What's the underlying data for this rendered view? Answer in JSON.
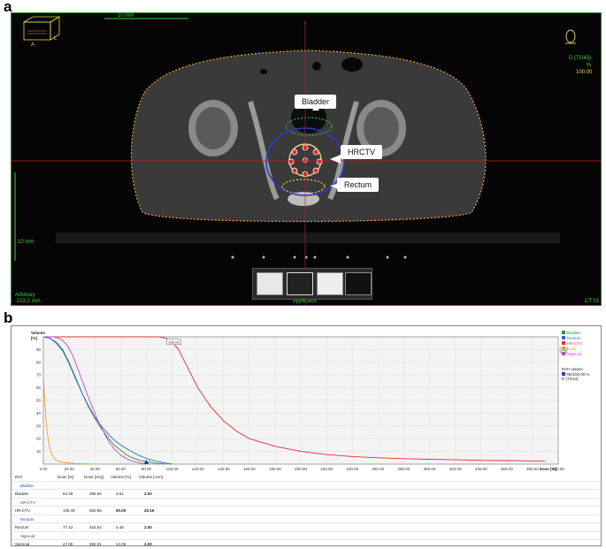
{
  "panels": {
    "a_label": "a",
    "b_label": "b"
  },
  "ct_view": {
    "scale_top": "10 mm",
    "scale_left": "10 mm",
    "orient_a": "A",
    "orient_l": "L",
    "top_marker": "x",
    "dose_label": "D (TG43)",
    "dose_unit": "%",
    "dose_value": "100.00",
    "bottom_left_1": "Arbitrary",
    "bottom_left_2": "-223.2 mm",
    "bottom_center": "Applicator",
    "bottom_right": "CT 01",
    "callouts": {
      "bladder": "Bladder",
      "hrctv": "HRCTV",
      "rectum": "Rectum"
    },
    "colors": {
      "bladder": "#3cb83c",
      "rectum": "#e8d44a",
      "hrctv": "#e03030",
      "body": "#f0a030",
      "isodose": "#2a3ad0"
    }
  },
  "dvh": {
    "y_axis_label": "Volume",
    "y_axis_unit": "[%]",
    "x_axis_label": "Dose [%]",
    "box_label": "[%]",
    "tooltip": "100.00",
    "legend": [
      {
        "name": "Bladder",
        "color": "#2a9a2a"
      },
      {
        "name": "Rectum",
        "color": "#2a6ad0"
      },
      {
        "name": "HR-CTV",
        "color": "#e03030"
      },
      {
        "name": "Body",
        "color": "#f0a030"
      },
      {
        "name": "Sigmoid",
        "color": "#d040d0"
      }
    ],
    "dvh_values_label": "DVH values",
    "dvh_values_item": "ND",
    "dvh_values_num": "100.00 %",
    "dvh_footer": "D (TG43)",
    "table": {
      "headers": [
        "ROI",
        "Dose [%]",
        "Dose [cGy]",
        "Volume [%]",
        "Volume [ccm]"
      ],
      "rows": [
        {
          "group": "Bladder",
          "roi": "Bladder",
          "dose_pct": "64.49",
          "dose_cgy": "386.94",
          "vol_pct": "4.61",
          "vol_ccm": "2.00"
        },
        {
          "group": "HR-CTV",
          "roi": "HR-CTV",
          "dose_pct": "108.49",
          "dose_cgy": "650.95",
          "vol_pct": "90.00",
          "vol_ccm": "20.19"
        },
        {
          "group": "Rectum",
          "roi": "Rectum",
          "dose_pct": "77.42",
          "dose_cgy": "464.54",
          "vol_pct": "4.49",
          "vol_ccm": "2.00"
        },
        {
          "group": "Sigmoid",
          "roi": "Sigmoid",
          "dose_pct": "47.00",
          "dose_cgy": "282.01",
          "vol_pct": "14.06",
          "vol_ccm": "2.00"
        }
      ]
    }
  },
  "chart_data": {
    "type": "line",
    "title": "",
    "xlabel": "Dose [%]",
    "ylabel": "Volume [%]",
    "xlim": [
      0,
      400
    ],
    "ylim": [
      0,
      100
    ],
    "x_ticks": [
      "0.00",
      "20.00",
      "40.00",
      "60.00",
      "80.00",
      "100.00",
      "120.00",
      "140.00",
      "160.00",
      "180.00",
      "200.00",
      "220.00",
      "240.00",
      "260.00",
      "280.00",
      "300.00",
      "320.00",
      "340.00",
      "360.00",
      "380.00",
      "400.00"
    ],
    "y_ticks": [
      "10",
      "20",
      "30",
      "40",
      "50",
      "60",
      "70",
      "80",
      "90"
    ],
    "grid": true,
    "legend_position": "top-right",
    "series": [
      {
        "name": "Bladder",
        "color": "#2a9a2a",
        "points": [
          [
            0,
            100
          ],
          [
            5,
            99
          ],
          [
            10,
            96
          ],
          [
            15,
            90
          ],
          [
            20,
            80
          ],
          [
            25,
            68
          ],
          [
            30,
            56
          ],
          [
            35,
            45
          ],
          [
            40,
            36
          ],
          [
            45,
            28
          ],
          [
            50,
            21
          ],
          [
            55,
            15
          ],
          [
            60,
            11
          ],
          [
            65,
            7
          ],
          [
            70,
            4.6
          ],
          [
            75,
            3
          ],
          [
            80,
            2
          ],
          [
            85,
            1
          ],
          [
            90,
            0.5
          ],
          [
            95,
            0
          ]
        ]
      },
      {
        "name": "Rectum",
        "color": "#2a6ad0",
        "points": [
          [
            0,
            100
          ],
          [
            5,
            99
          ],
          [
            10,
            95
          ],
          [
            15,
            89
          ],
          [
            20,
            79
          ],
          [
            25,
            67
          ],
          [
            30,
            56
          ],
          [
            35,
            46
          ],
          [
            40,
            37
          ],
          [
            45,
            30
          ],
          [
            50,
            24
          ],
          [
            55,
            19
          ],
          [
            60,
            15
          ],
          [
            65,
            12
          ],
          [
            70,
            9
          ],
          [
            75,
            6.5
          ],
          [
            80,
            4.5
          ],
          [
            85,
            3
          ],
          [
            90,
            1.8
          ],
          [
            95,
            0.8
          ],
          [
            100,
            0
          ]
        ]
      },
      {
        "name": "HR-CTV",
        "color": "#e03030",
        "points": [
          [
            0,
            100
          ],
          [
            20,
            100
          ],
          [
            60,
            100
          ],
          [
            90,
            100
          ],
          [
            95,
            99
          ],
          [
            100,
            96
          ],
          [
            105,
            90
          ],
          [
            110,
            80
          ],
          [
            115,
            70
          ],
          [
            120,
            60
          ],
          [
            130,
            45
          ],
          [
            140,
            34
          ],
          [
            150,
            26
          ],
          [
            160,
            20
          ],
          [
            180,
            14
          ],
          [
            200,
            10
          ],
          [
            220,
            7.5
          ],
          [
            240,
            6
          ],
          [
            260,
            5
          ],
          [
            280,
            4.3
          ],
          [
            300,
            3.8
          ],
          [
            320,
            3.4
          ],
          [
            340,
            3
          ],
          [
            360,
            2.8
          ],
          [
            380,
            2.5
          ],
          [
            390,
            2.3
          ]
        ]
      },
      {
        "name": "Body",
        "color": "#f0a030",
        "points": [
          [
            0,
            70
          ],
          [
            1,
            50
          ],
          [
            2,
            35
          ],
          [
            3,
            25
          ],
          [
            4,
            18
          ],
          [
            5,
            13
          ],
          [
            6,
            9
          ],
          [
            8,
            5
          ],
          [
            10,
            3
          ],
          [
            15,
            1.5
          ],
          [
            25,
            0.5
          ],
          [
            40,
            0
          ]
        ]
      },
      {
        "name": "Sigmoid",
        "color": "#d040d0",
        "points": [
          [
            0,
            100
          ],
          [
            8,
            100
          ],
          [
            14,
            98
          ],
          [
            18,
            94
          ],
          [
            22,
            87
          ],
          [
            26,
            77
          ],
          [
            30,
            66
          ],
          [
            34,
            55
          ],
          [
            38,
            45
          ],
          [
            42,
            35
          ],
          [
            46,
            27
          ],
          [
            50,
            19
          ],
          [
            55,
            12
          ],
          [
            60,
            7
          ],
          [
            65,
            4
          ],
          [
            70,
            2
          ],
          [
            75,
            1
          ],
          [
            80,
            0
          ]
        ]
      }
    ]
  }
}
